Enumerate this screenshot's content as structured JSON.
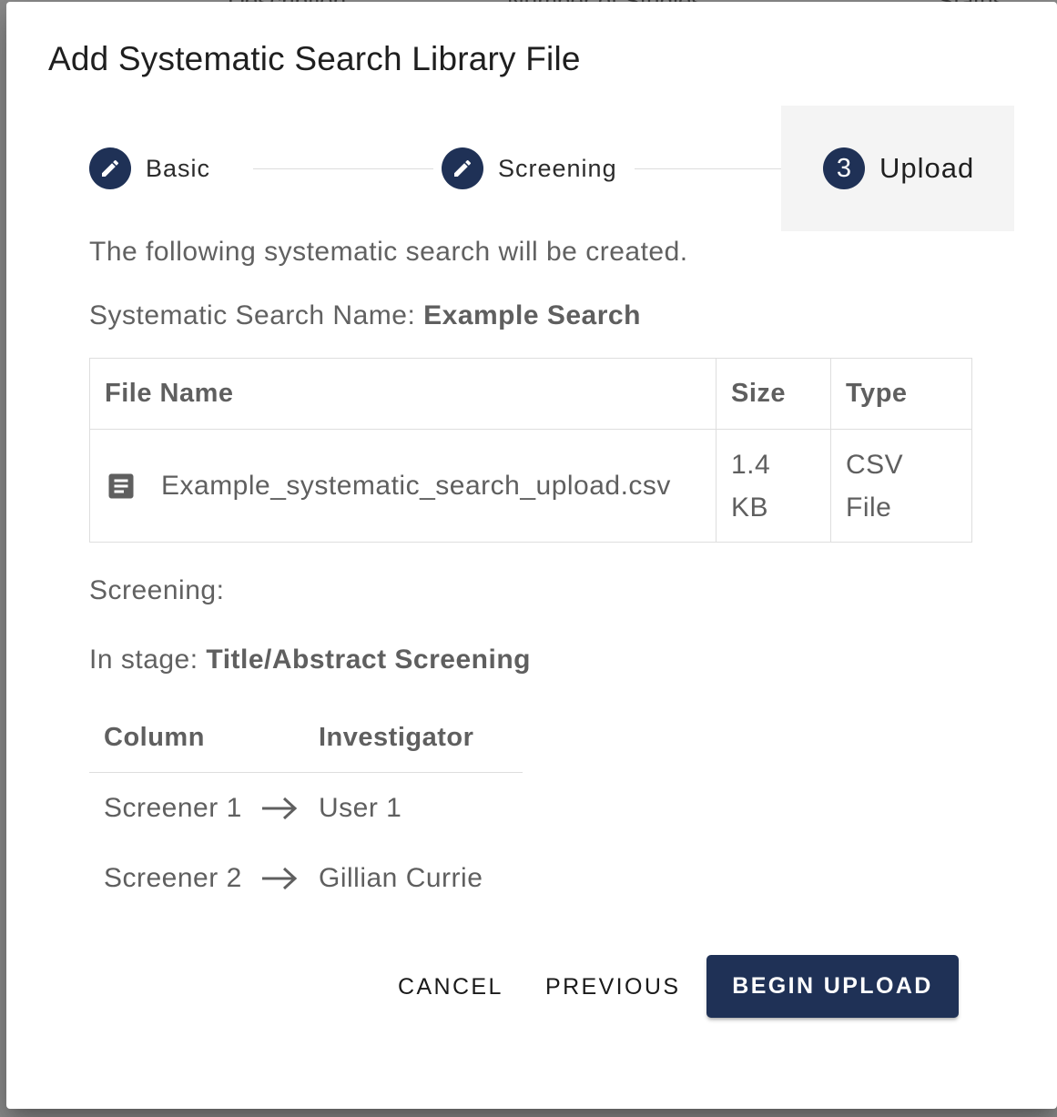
{
  "background": {
    "header_fragments": [
      "Description",
      "Number of Studies",
      "Status"
    ]
  },
  "dialog": {
    "title": "Add Systematic Search Library File"
  },
  "stepper": {
    "steps": [
      {
        "label": "Basic",
        "state": "completed",
        "icon": "edit-pencil-icon"
      },
      {
        "label": "Screening",
        "state": "completed",
        "icon": "edit-pencil-icon"
      },
      {
        "label": "Upload",
        "state": "active",
        "number": "3"
      }
    ],
    "accent_color": "#1f3156"
  },
  "summary": {
    "intro": "The following systematic search will be created.",
    "name_label": "Systematic Search Name: ",
    "name_value": "Example Search"
  },
  "files_table": {
    "headers": [
      "File Name",
      "Size",
      "Type"
    ],
    "rows": [
      {
        "icon": "document-icon",
        "name": "Example_systematic_search_upload.csv",
        "size_line1": "1.4",
        "size_line2": "KB",
        "type_line1": "CSV",
        "type_line2": "File"
      }
    ]
  },
  "screening": {
    "label": "Screening:",
    "stage_label": "In stage: ",
    "stage_value": "Title/Abstract Screening",
    "headers": [
      "Column",
      "Investigator"
    ],
    "rows": [
      {
        "column": "Screener 1",
        "investigator": "User 1"
      },
      {
        "column": "Screener 2",
        "investigator": "Gillian Currie"
      }
    ]
  },
  "actions": {
    "cancel": "CANCEL",
    "previous": "PREVIOUS",
    "begin_upload": "BEGIN UPLOAD"
  }
}
